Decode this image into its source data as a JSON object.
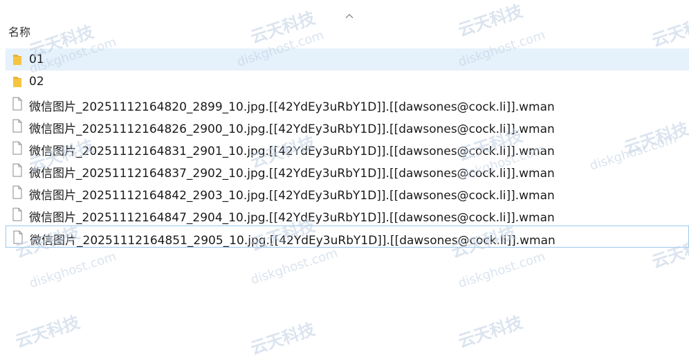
{
  "column_header": {
    "name_label": "名称",
    "sort_icon": "chevron-up-icon"
  },
  "files": [
    {
      "name": "01",
      "type": "folder",
      "selected": true
    },
    {
      "name": "02",
      "type": "folder"
    },
    {
      "name": "微信图片_20251112164820_2899_10.jpg.[[42YdEy3uRbY1D]].[[dawsones@cock.li]].wman",
      "type": "file"
    },
    {
      "name": "微信图片_20251112164826_2900_10.jpg.[[42YdEy3uRbY1D]].[[dawsones@cock.li]].wman",
      "type": "file"
    },
    {
      "name": "微信图片_20251112164831_2901_10.jpg.[[42YdEy3uRbY1D]].[[dawsones@cock.li]].wman",
      "type": "file"
    },
    {
      "name": "微信图片_20251112164837_2902_10.jpg.[[42YdEy3uRbY1D]].[[dawsones@cock.li]].wman",
      "type": "file"
    },
    {
      "name": "微信图片_20251112164842_2903_10.jpg.[[42YdEy3uRbY1D]].[[dawsones@cock.li]].wman",
      "type": "file"
    },
    {
      "name": "微信图片_20251112164847_2904_10.jpg.[[42YdEy3uRbY1D]].[[dawsones@cock.li]].wman",
      "type": "file"
    },
    {
      "name": "微信图片_20251112164851_2905_10.jpg.[[42YdEy3uRbY1D]].[[dawsones@cock.li]].wman",
      "type": "file",
      "focused": true
    }
  ],
  "watermark": {
    "logo_text": "云天科技",
    "url_text": "diskghost.com"
  },
  "colors": {
    "selection": "#e5f1fb",
    "focus_border": "#99c9ef",
    "folder": "#f5c542"
  }
}
